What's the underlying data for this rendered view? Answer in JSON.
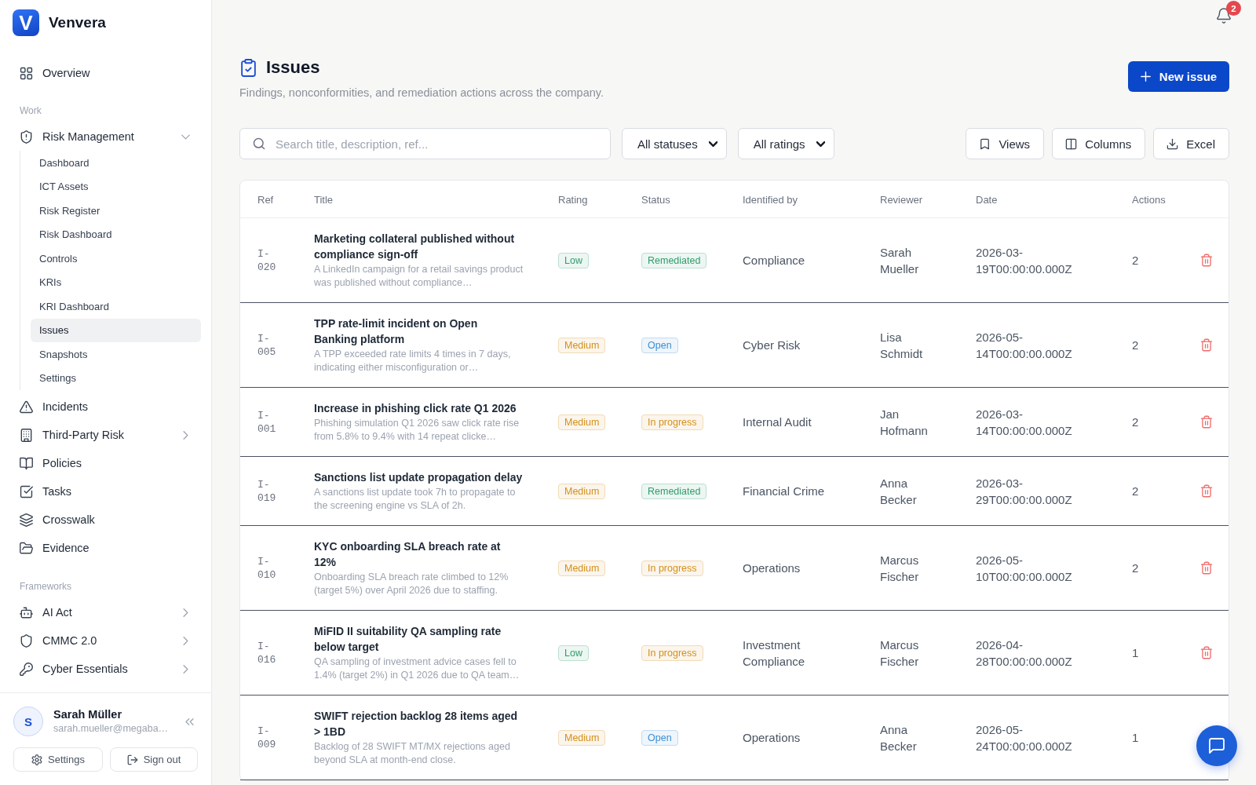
{
  "app": {
    "logo_mark": "V",
    "name": "Venvera"
  },
  "sidebar": {
    "groups": [
      {
        "items": [
          {
            "label": "Overview",
            "kind": "link",
            "selected": false
          }
        ]
      },
      {
        "heading": "Work",
        "items": [
          {
            "label": "Risk Management",
            "kind": "group",
            "selected": false,
            "expanded": true,
            "children": [
              {
                "label": "Dashboard",
                "selected": false
              },
              {
                "label": "ICT Assets",
                "selected": false
              },
              {
                "label": "Risk Register",
                "selected": false
              },
              {
                "label": "Risk Dashboard",
                "selected": false
              },
              {
                "label": "Controls",
                "selected": false
              },
              {
                "label": "KRIs",
                "selected": false
              },
              {
                "label": "KRI Dashboard",
                "selected": false
              },
              {
                "label": "Issues",
                "selected": true
              },
              {
                "label": "Snapshots",
                "selected": false
              },
              {
                "label": "Settings",
                "selected": false
              }
            ]
          },
          {
            "label": "Incidents",
            "kind": "link",
            "selected": false
          },
          {
            "label": "Third-Party Risk",
            "kind": "group",
            "selected": false,
            "expanded": false
          },
          {
            "label": "Policies",
            "kind": "link",
            "selected": false
          },
          {
            "label": "Tasks",
            "kind": "link",
            "selected": false
          },
          {
            "label": "Crosswalk",
            "kind": "link",
            "selected": false
          },
          {
            "label": "Evidence",
            "kind": "link",
            "selected": false
          }
        ]
      },
      {
        "heading": "Frameworks",
        "items": [
          {
            "label": "AI Act",
            "kind": "group",
            "selected": false,
            "expanded": false
          },
          {
            "label": "CMMC 2.0",
            "kind": "group",
            "selected": false,
            "expanded": false
          },
          {
            "label": "Cyber Essentials",
            "kind": "group",
            "selected": false,
            "expanded": false
          }
        ]
      }
    ]
  },
  "user": {
    "initial": "S",
    "name": "Sarah Müller",
    "email": "sarah.mueller@megaba…",
    "buttons": [
      {
        "label": "Settings"
      },
      {
        "label": "Sign out"
      }
    ]
  },
  "notifications": {
    "count": "2"
  },
  "page": {
    "title": "Issues",
    "subtitle": "Findings, nonconformities, and remediation actions across the company.",
    "primary_button": "New issue"
  },
  "toolbar": {
    "search": {
      "placeholder": "Search title, description, ref..."
    },
    "filters": [
      {
        "value": "All statuses"
      },
      {
        "value": "All ratings"
      }
    ],
    "buttons": [
      "Views",
      "Columns",
      "Excel"
    ]
  },
  "table": {
    "columns": [
      "Ref",
      "Title",
      "Rating",
      "Status",
      "Identified by",
      "Reviewer",
      "Date",
      "Actions"
    ],
    "rows": [
      {
        "ref": "I-020",
        "title": "Marketing collateral published without compliance sign-off",
        "description": "A LinkedIn campaign for a retail savings product was published without compliance…",
        "rating": {
          "label": "Low",
          "color": "#2e9d6b"
        },
        "status": {
          "label": "Remediated",
          "color": "#2e9d6b"
        },
        "identified_by": "Compliance",
        "reviewer": "Sarah Mueller",
        "date": "2026-03-19T00:00:00.000Z",
        "actions": "2",
        "delete_button": true
      },
      {
        "ref": "I-005",
        "title": "TPP rate-limit incident on Open Banking platform",
        "description": "A TPP exceeded rate limits 4 times in 7 days, indicating either misconfiguration or…",
        "rating": {
          "label": "Medium",
          "color": "#d4901c"
        },
        "status": {
          "label": "Open",
          "color": "#3d8fd4"
        },
        "identified_by": "Cyber Risk",
        "reviewer": "Lisa Schmidt",
        "date": "2026-05-14T00:00:00.000Z",
        "actions": "2",
        "delete_button": true
      },
      {
        "ref": "I-001",
        "title": "Increase in phishing click rate Q1 2026",
        "description": "Phishing simulation Q1 2026 saw click rate rise from 5.8% to 9.4% with 14 repeat clicke…",
        "rating": {
          "label": "Medium",
          "color": "#d4901c"
        },
        "status": {
          "label": "In progress",
          "color": "#d4901c"
        },
        "identified_by": "Internal Audit",
        "reviewer": "Jan Hofmann",
        "date": "2026-03-14T00:00:00.000Z",
        "actions": "2",
        "delete_button": true
      },
      {
        "ref": "I-019",
        "title": "Sanctions list update propagation delay",
        "description": "A sanctions list update took 7h to propagate to the screening engine vs SLA of 2h.",
        "rating": {
          "label": "Medium",
          "color": "#d4901c"
        },
        "status": {
          "label": "Remediated",
          "color": "#2e9d6b"
        },
        "identified_by": "Financial Crime",
        "reviewer": "Anna Becker",
        "date": "2026-03-29T00:00:00.000Z",
        "actions": "2",
        "delete_button": true
      },
      {
        "ref": "I-010",
        "title": "KYC onboarding SLA breach rate at 12%",
        "description": "Onboarding SLA breach rate climbed to 12% (target 5%) over April 2026 due to staffing.",
        "rating": {
          "label": "Medium",
          "color": "#d4901c"
        },
        "status": {
          "label": "In progress",
          "color": "#d4901c"
        },
        "identified_by": "Operations",
        "reviewer": "Marcus Fischer",
        "date": "2026-05-10T00:00:00.000Z",
        "actions": "2",
        "delete_button": true
      },
      {
        "ref": "I-016",
        "title": "MiFID II suitability QA sampling rate below target",
        "description": "QA sampling of investment advice cases fell to 1.4% (target 2%) in Q1 2026 due to QA team…",
        "rating": {
          "label": "Low",
          "color": "#2e9d6b"
        },
        "status": {
          "label": "In progress",
          "color": "#d4901c"
        },
        "identified_by": "Investment Compliance",
        "reviewer": "Marcus Fischer",
        "date": "2026-04-28T00:00:00.000Z",
        "actions": "1",
        "delete_button": true
      },
      {
        "ref": "I-009",
        "title": "SWIFT rejection backlog 28 items aged > 1BD",
        "description": "Backlog of 28 SWIFT MT/MX rejections aged beyond SLA at month-end close.",
        "rating": {
          "label": "Medium",
          "color": "#d4901c"
        },
        "status": {
          "label": "Open",
          "color": "#3d8fd4"
        },
        "identified_by": "Operations",
        "reviewer": "Anna Becker",
        "date": "2026-05-24T00:00:00.000Z",
        "actions": "1"
      }
    ]
  }
}
